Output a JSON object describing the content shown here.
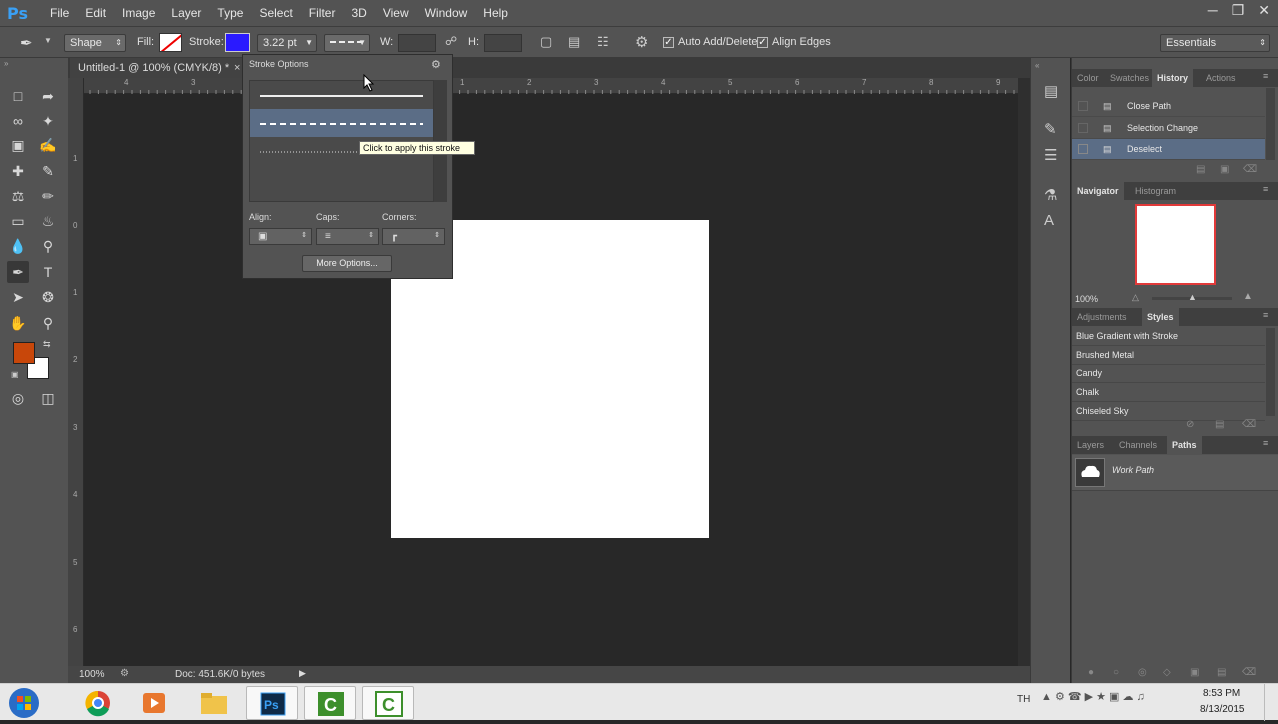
{
  "app": {
    "logo": "Ps",
    "menu": [
      "File",
      "Edit",
      "Image",
      "Layer",
      "Type",
      "Select",
      "Filter",
      "3D",
      "View",
      "Window",
      "Help"
    ]
  },
  "options_bar": {
    "mode": "Shape",
    "fill_label": "Fill:",
    "stroke_label": "Stroke:",
    "stroke_color": "#2a1aff",
    "stroke_width": "3.22 pt",
    "w_label": "W:",
    "h_label": "H:",
    "auto_add_delete": "Auto Add/Delete",
    "align_edges": "Align Edges",
    "workspace": "Essentials"
  },
  "document": {
    "tab_title": "Untitled-1 @ 100% (CMYK/8) *",
    "zoom": "100%",
    "doc_info": "Doc: 451.6K/0 bytes",
    "h_ruler_ticks": [
      "4",
      "3",
      "2",
      "1",
      "0",
      "1",
      "2",
      "3",
      "4",
      "5",
      "6",
      "7",
      "8",
      "9",
      "10"
    ],
    "v_ruler_ticks": [
      "1",
      "0",
      "1",
      "2",
      "3",
      "4",
      "5",
      "6"
    ]
  },
  "colors": {
    "foreground": "#c8470a",
    "background": "#ffffff",
    "selection": "#5b6d86"
  },
  "stroke_options": {
    "title": "Stroke Options",
    "styles": [
      "solid",
      "dashed",
      "dotted"
    ],
    "selected_style": "dashed",
    "tooltip": "Click to apply this stroke",
    "align_label": "Align:",
    "caps_label": "Caps:",
    "corners_label": "Corners:",
    "more_options": "More Options..."
  },
  "history_panel": {
    "tabs": [
      "Color",
      "Swatches",
      "History",
      "Actions"
    ],
    "active_tab": "History",
    "items": [
      "Close Path",
      "Selection Change",
      "Deselect"
    ],
    "selected": "Deselect"
  },
  "navigator_panel": {
    "tabs": [
      "Navigator",
      "Histogram"
    ],
    "active_tab": "Navigator",
    "zoom": "100%"
  },
  "styles_panel": {
    "tabs": [
      "Adjustments",
      "Styles"
    ],
    "active_tab": "Styles",
    "items": [
      "Blue Gradient with Stroke",
      "Brushed Metal",
      "Candy",
      "Chalk",
      "Chiseled Sky"
    ]
  },
  "paths_panel": {
    "tabs": [
      "Layers",
      "Channels",
      "Paths"
    ],
    "active_tab": "Paths",
    "items": [
      "Work Path"
    ]
  },
  "taskbar": {
    "lang": "TH",
    "time": "8:53 PM",
    "date": "8/13/2015"
  }
}
